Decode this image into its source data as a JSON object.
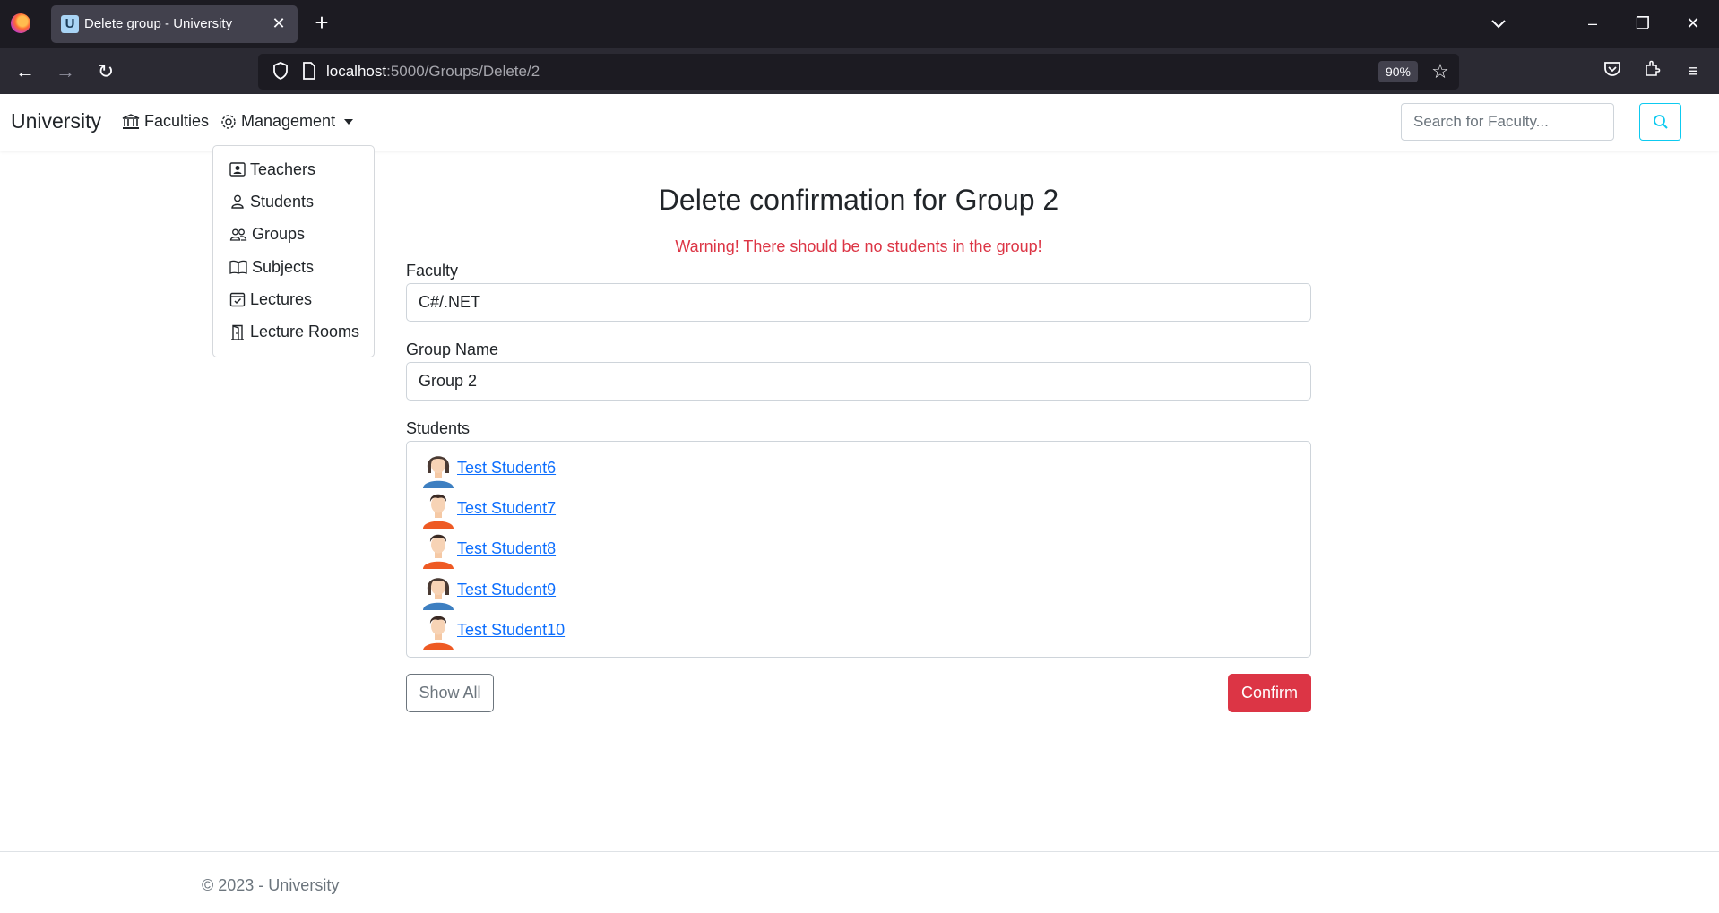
{
  "browser": {
    "tab_title": "Delete group - University",
    "tab_favicon_letter": "U",
    "url_host": "localhost",
    "url_path": ":5000/Groups/Delete/2",
    "zoom": "90%"
  },
  "navbar": {
    "brand": "University",
    "faculties_label": "Faculties",
    "management_label": "Management",
    "search_placeholder": "Search for Faculty..."
  },
  "dropdown": {
    "items": [
      {
        "label": "Teachers",
        "icon": "teacher-icon"
      },
      {
        "label": "Students",
        "icon": "person-icon"
      },
      {
        "label": "Groups",
        "icon": "people-icon"
      },
      {
        "label": "Subjects",
        "icon": "book-icon"
      },
      {
        "label": "Lectures",
        "icon": "calendar-check-icon"
      },
      {
        "label": "Lecture Rooms",
        "icon": "door-icon"
      }
    ]
  },
  "main": {
    "title": "Delete confirmation for Group 2",
    "warning": "Warning! There should be no students in the group!",
    "faculty_label": "Faculty",
    "faculty_value": "C#/.NET",
    "group_name_label": "Group Name",
    "group_name_value": "Group 2",
    "students_label": "Students",
    "students": [
      {
        "name": " Test Student6",
        "avatar": "female-avatar"
      },
      {
        "name": " Test Student7",
        "avatar": "male-avatar"
      },
      {
        "name": " Test Student8",
        "avatar": "male-avatar"
      },
      {
        "name": " Test Student9",
        "avatar": "female-avatar"
      },
      {
        "name": " Test Student10",
        "avatar": "male-avatar"
      }
    ],
    "show_all_label": "Show All",
    "confirm_label": "Confirm"
  },
  "footer": {
    "text": "© 2023 - University"
  },
  "colors": {
    "danger": "#dc3545",
    "link": "#0d6efd",
    "search_outline": "#0dcaf0"
  }
}
